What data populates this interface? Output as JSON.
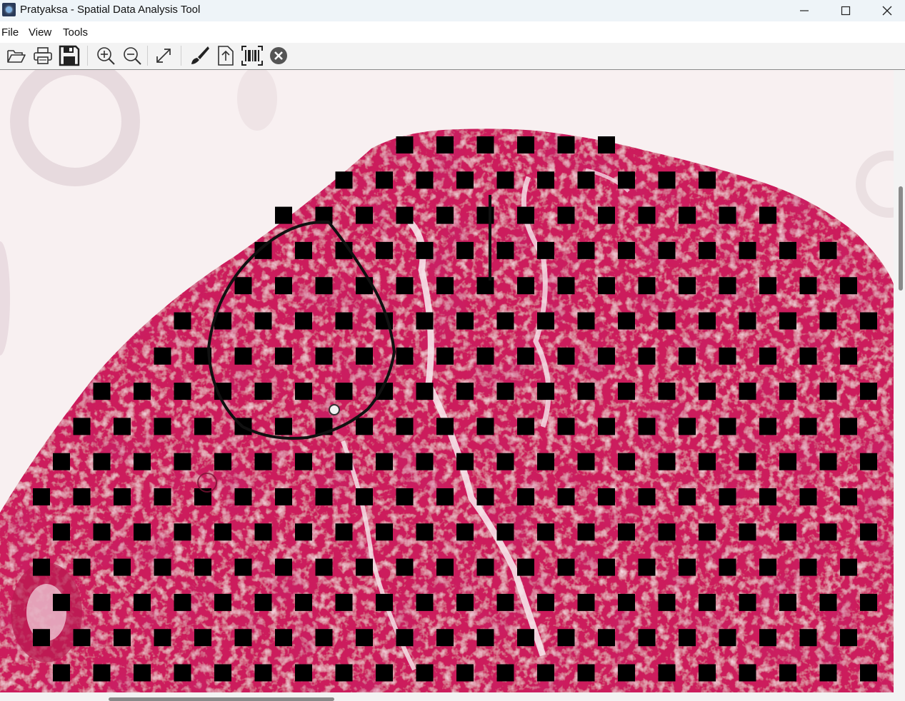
{
  "window": {
    "title": "Pratyaksa - Spatial Data Analysis Tool",
    "controls": [
      "minimize",
      "maximize",
      "close"
    ]
  },
  "menu": {
    "items": [
      {
        "label": "File"
      },
      {
        "label": "View"
      },
      {
        "label": "Tools"
      }
    ]
  },
  "toolbar": {
    "buttons": [
      {
        "icon": "open-folder-icon"
      },
      {
        "icon": "print-icon"
      },
      {
        "icon": "save-icon"
      },
      {
        "icon": "zoom-in-icon"
      },
      {
        "icon": "zoom-out-icon"
      },
      {
        "icon": "fit-to-window-icon"
      },
      {
        "icon": "brush-icon"
      },
      {
        "icon": "export-icon"
      },
      {
        "icon": "barcode-icon"
      },
      {
        "icon": "clear-icon"
      }
    ]
  },
  "viewer": {
    "content": "tissue section image with spot grid overlay",
    "colors": {
      "tissue": "#cc1f5c",
      "tissue_dark": "#a8103f",
      "background": "#f7efef",
      "spots": "#000000"
    }
  }
}
